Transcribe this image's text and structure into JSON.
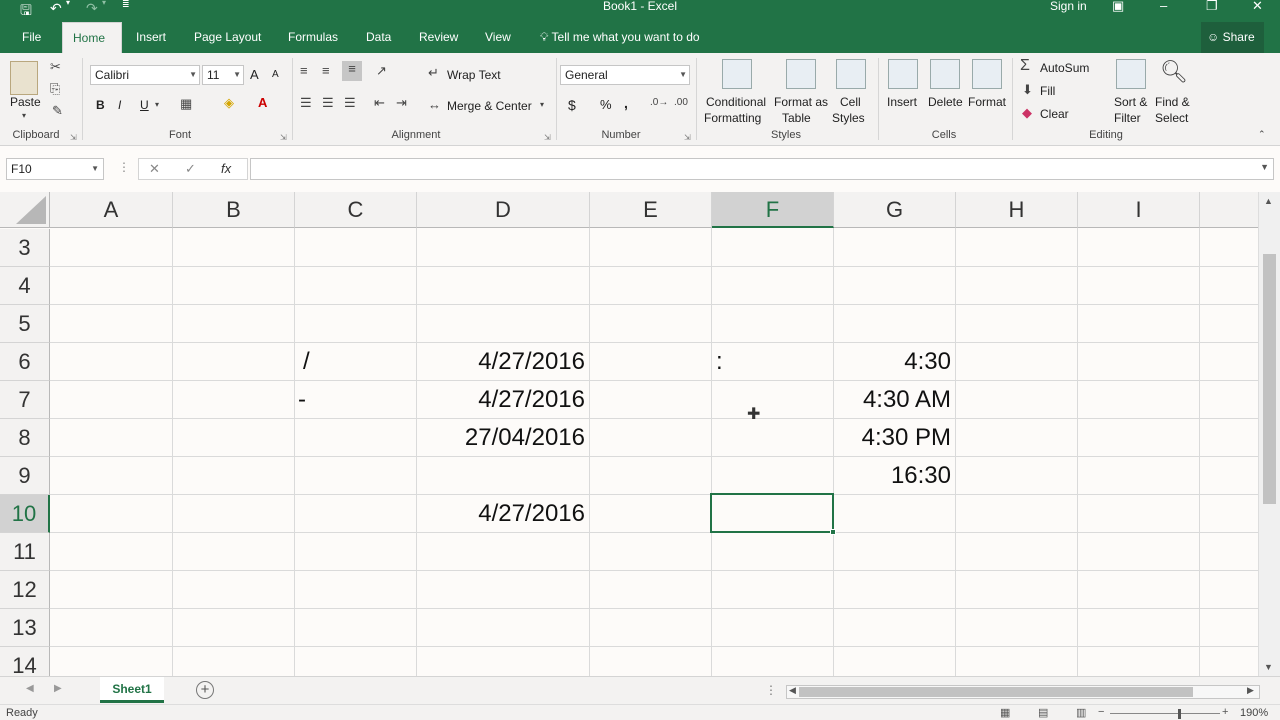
{
  "window": {
    "title": "Book1 - Excel",
    "signin": "Sign in",
    "icons": [
      "save-icon",
      "undo-icon",
      "redo-icon",
      "customize-qat-icon"
    ],
    "buttons": [
      "ribbon-display-icon",
      "minimize-icon",
      "restore-icon",
      "close-icon"
    ]
  },
  "tabs": [
    "File",
    "Home",
    "Insert",
    "Page Layout",
    "Formulas",
    "Data",
    "Review",
    "View"
  ],
  "active_tab": "Home",
  "tell_me": "Tell me what you want to do",
  "share": "Share",
  "ribbon": {
    "clipboard": {
      "paste": "Paste",
      "label": "Clipboard"
    },
    "font": {
      "name": "Calibri",
      "size": "11",
      "label": "Font",
      "bold": "B",
      "italic": "I",
      "underline": "U",
      "grow": "A",
      "shrink": "A"
    },
    "alignment": {
      "wrap": "Wrap Text",
      "merge": "Merge & Center",
      "label": "Alignment"
    },
    "number": {
      "format": "General",
      "label": "Number",
      "currency": "$",
      "percent": "%",
      "comma": ","
    },
    "styles": {
      "conditional1": "Conditional",
      "conditional2": "Formatting",
      "table1": "Format as",
      "table2": "Table",
      "cell1": "Cell",
      "cell2": "Styles",
      "label": "Styles"
    },
    "cells": {
      "insert": "Insert",
      "delete": "Delete",
      "format": "Format",
      "label": "Cells"
    },
    "editing": {
      "autosum": "AutoSum",
      "fill": "Fill",
      "clear": "Clear",
      "sort1": "Sort &",
      "sort2": "Filter",
      "find1": "Find &",
      "find2": "Select",
      "label": "Editing"
    }
  },
  "formula_bar": {
    "name_box": "F10",
    "fx": "fx",
    "cancel": "✕",
    "enter": "✓",
    "value": ""
  },
  "columns": [
    "A",
    "B",
    "C",
    "D",
    "E",
    "F",
    "G",
    "H",
    "I"
  ],
  "selected_column": "F",
  "rows": [
    "3",
    "4",
    "5",
    "6",
    "7",
    "8",
    "9",
    "10",
    "11",
    "12",
    "13",
    "14"
  ],
  "selected_row": "10",
  "cells": {
    "C6": "/",
    "C7": "-",
    "D6": "4/27/2016",
    "D7": "4/27/2016",
    "D8": "27/04/2016",
    "D10": "4/27/2016",
    "F6": ":",
    "G6": "4:30",
    "G7": "4:30 AM",
    "G8": "4:30 PM",
    "G9": "16:30"
  },
  "sheet": {
    "tab": "Sheet1"
  },
  "status": {
    "text": "Ready",
    "zoom": "190%"
  }
}
